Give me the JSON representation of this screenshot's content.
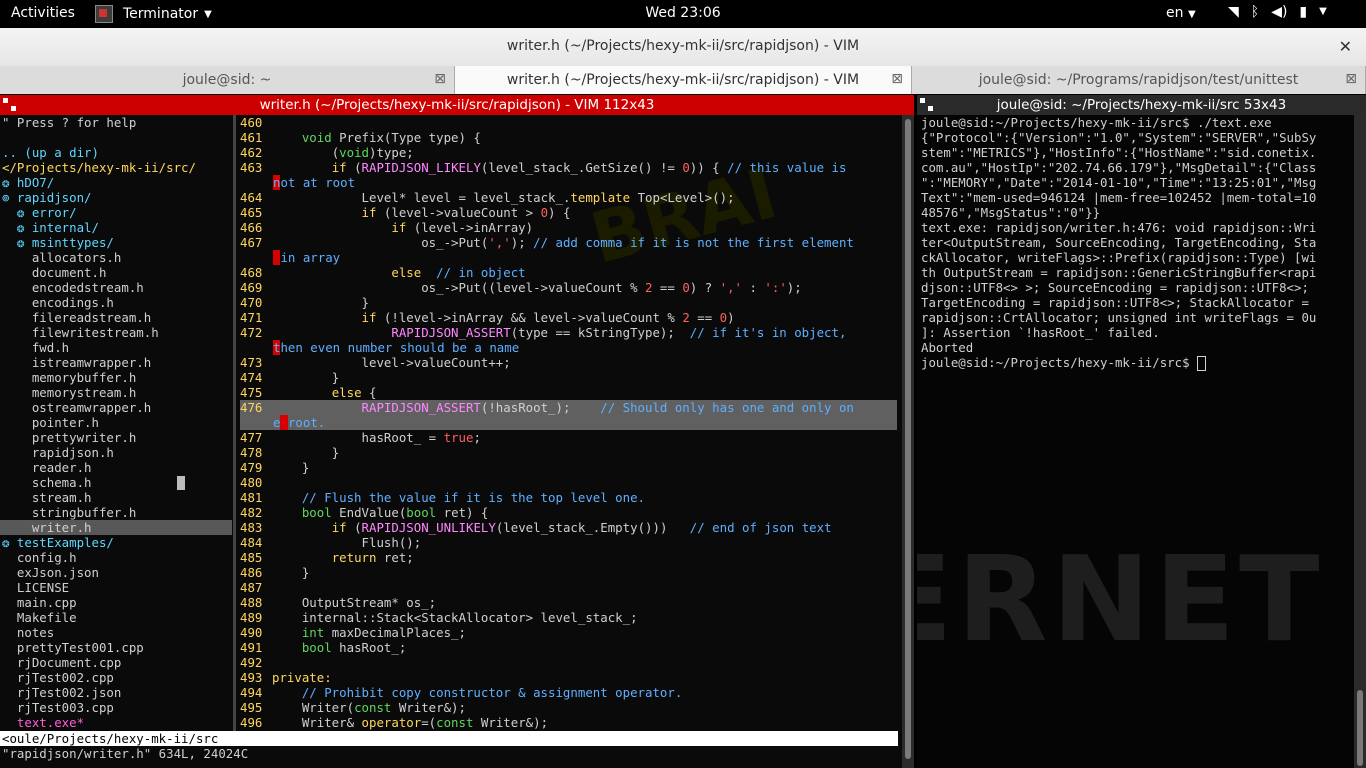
{
  "topbar": {
    "activities": "Activities",
    "app_name": "Terminator",
    "clock": "Wed 23:06",
    "lang": "en"
  },
  "window": {
    "title": "writer.h (~/Projects/hexy-mk-ii/src/rapidjson) - VIM"
  },
  "tabs": [
    {
      "label": "joule@sid: ~"
    },
    {
      "label": "writer.h (~/Projects/hexy-mk-ii/src/rapidjson) - VIM"
    },
    {
      "label": "joule@sid: ~/Programs/rapidjson/test/unittest"
    }
  ],
  "left_pane": {
    "title": "writer.h (~/Projects/hexy-mk-ii/src/rapidjson) - VIM 112x43",
    "tree": [
      {
        "text": "\" Press ? for help",
        "cls": "c-help"
      },
      {
        "text": "",
        "cls": "c-file"
      },
      {
        "text": ".. (up a dir)",
        "cls": "c-dir"
      },
      {
        "text": "</Projects/hexy-mk-ii/src/",
        "cls": "c-hdr"
      },
      {
        "text": "❂ hDO7/",
        "cls": "c-dir"
      },
      {
        "text": "⊚ rapidjson/",
        "cls": "c-dir"
      },
      {
        "text": "  ❂ error/",
        "cls": "c-dir"
      },
      {
        "text": "  ❂ internal/",
        "cls": "c-dir"
      },
      {
        "text": "  ❂ msinttypes/",
        "cls": "c-dir"
      },
      {
        "text": "    allocators.h",
        "cls": "c-file"
      },
      {
        "text": "    document.h",
        "cls": "c-file"
      },
      {
        "text": "    encodedstream.h",
        "cls": "c-file"
      },
      {
        "text": "    encodings.h",
        "cls": "c-file"
      },
      {
        "text": "    filereadstream.h",
        "cls": "c-file"
      },
      {
        "text": "    filewritestream.h",
        "cls": "c-file"
      },
      {
        "text": "    fwd.h",
        "cls": "c-file"
      },
      {
        "text": "    istreamwrapper.h",
        "cls": "c-file"
      },
      {
        "text": "    memorybuffer.h",
        "cls": "c-file"
      },
      {
        "text": "    memorystream.h",
        "cls": "c-file"
      },
      {
        "text": "    ostreamwrapper.h",
        "cls": "c-file"
      },
      {
        "text": "    pointer.h",
        "cls": "c-file"
      },
      {
        "text": "    prettywriter.h",
        "cls": "c-file"
      },
      {
        "text": "    rapidjson.h",
        "cls": "c-file"
      },
      {
        "text": "    reader.h",
        "cls": "c-file"
      },
      {
        "text": "    schema.h",
        "cls": "c-file"
      },
      {
        "text": "    stream.h",
        "cls": "c-file"
      },
      {
        "text": "    stringbuffer.h",
        "cls": "c-file"
      },
      {
        "text": "    writer.h",
        "cls": "c-file sel"
      },
      {
        "text": "❂ testExamples/",
        "cls": "c-dir"
      },
      {
        "text": "  config.h",
        "cls": "c-file"
      },
      {
        "text": "  exJson.json",
        "cls": "c-file"
      },
      {
        "text": "  LICENSE",
        "cls": "c-file"
      },
      {
        "text": "  main.cpp",
        "cls": "c-file"
      },
      {
        "text": "  Makefile",
        "cls": "c-file"
      },
      {
        "text": "  notes",
        "cls": "c-file"
      },
      {
        "text": "  prettyTest001.cpp",
        "cls": "c-file"
      },
      {
        "text": "  rjDocument.cpp",
        "cls": "c-file"
      },
      {
        "text": "  rjTest002.cpp",
        "cls": "c-file"
      },
      {
        "text": "  rjTest002.json",
        "cls": "c-file"
      },
      {
        "text": "  rjTest003.cpp",
        "cls": "c-file"
      },
      {
        "text": "  text.exe*",
        "cls": "c-exe"
      }
    ],
    "code": [
      {
        "n": "460",
        "html": ""
      },
      {
        "n": "461",
        "html": "    <span class='ty'>void</span> <span class='id'>Prefix(Type type) {</span>"
      },
      {
        "n": "462",
        "html": "        <span class='id'>(</span><span class='ty'>void</span><span class='id'>)type;</span>"
      },
      {
        "n": "463",
        "html": "        <span class='kw'>if</span> <span class='id'>(</span><span class='pp'>RAPIDJSON_LIKELY</span><span class='id'>(level_stack_.GetSize() != </span><span class='nm'>0</span><span class='id'>)) { </span><span class='cm'>// this value is</span>"
      },
      {
        "n": "",
        "html": "<span class='cm'><span class='err'>n</span>ot at root</span>"
      },
      {
        "n": "464",
        "html": "            <span class='id'>Level* level = level_stack_.</span><span class='kw'>template</span> <span class='id'>Top&lt;Level&gt;();</span>"
      },
      {
        "n": "465",
        "html": "            <span class='kw'>if</span> <span class='id'>(level-&gt;valueCount &gt; </span><span class='nm'>0</span><span class='id'>) {</span>"
      },
      {
        "n": "466",
        "html": "                <span class='kw'>if</span> <span class='id'>(level-&gt;inArray)</span>"
      },
      {
        "n": "467",
        "html": "                    <span class='id'>os_-&gt;Put(</span><span class='nm'>','</span><span class='id'>); </span><span class='cm'>// add comma if it is not the first element</span>"
      },
      {
        "n": "",
        "html": "<span class='cm'><span class='err'> </span>in array</span>"
      },
      {
        "n": "468",
        "html": "                <span class='kw'>else</span>  <span class='cm'>// in object</span>"
      },
      {
        "n": "469",
        "html": "                    <span class='id'>os_-&gt;Put((level-&gt;valueCount % </span><span class='nm'>2</span><span class='id'> == </span><span class='nm'>0</span><span class='id'>) ? </span><span class='nm'>','</span><span class='id'> : </span><span class='nm'>':'</span><span class='id'>);</span>"
      },
      {
        "n": "470",
        "html": "            <span class='id'>}</span>"
      },
      {
        "n": "471",
        "html": "            <span class='kw'>if</span> <span class='id'>(!level-&gt;inArray &amp;&amp; level-&gt;valueCount % </span><span class='nm'>2</span><span class='id'> == </span><span class='nm'>0</span><span class='id'>)</span>"
      },
      {
        "n": "472",
        "html": "                <span class='pp'>RAPIDJSON_ASSERT</span><span class='id'>(type == kStringType);  </span><span class='cm'>// if it's in object,</span>"
      },
      {
        "n": "",
        "html": "<span class='cm'><span class='err'>t</span>hen even number should be a name</span>"
      },
      {
        "n": "473",
        "html": "            <span class='id'>level-&gt;valueCount++;</span>"
      },
      {
        "n": "474",
        "html": "        <span class='id'>}</span>"
      },
      {
        "n": "475",
        "html": "        <span class='kw'>else</span> <span class='id'>{</span>"
      },
      {
        "n": "476",
        "html": "            <span class='pp'>RAPIDJSON_ASSERT</span><span class='id'>(!hasRoot_);    </span><span class='cm'>// Should only has one and only on</span>",
        "hl": true
      },
      {
        "n": "",
        "html": "<span class='cm'>e<span class='err'> </span>root.</span>",
        "hl": true
      },
      {
        "n": "477",
        "html": "            <span class='id'>hasRoot_ = </span><span class='nm'>true</span><span class='id'>;</span>"
      },
      {
        "n": "478",
        "html": "        <span class='id'>}</span>"
      },
      {
        "n": "479",
        "html": "    <span class='id'>}</span>"
      },
      {
        "n": "480",
        "html": ""
      },
      {
        "n": "481",
        "html": "    <span class='cm'>// Flush the value if it is the top level one.</span>"
      },
      {
        "n": "482",
        "html": "    <span class='ty'>bool</span> <span class='id'>EndValue(</span><span class='ty'>bool</span> <span class='id'>ret) {</span>"
      },
      {
        "n": "483",
        "html": "        <span class='kw'>if</span> <span class='id'>(</span><span class='pp'>RAPIDJSON_UNLIKELY</span><span class='id'>(level_stack_.Empty()))   </span><span class='cm'>// end of json text</span>"
      },
      {
        "n": "484",
        "html": "            <span class='id'>Flush();</span>"
      },
      {
        "n": "485",
        "html": "        <span class='kw'>return</span> <span class='id'>ret;</span>"
      },
      {
        "n": "486",
        "html": "    <span class='id'>}</span>"
      },
      {
        "n": "487",
        "html": ""
      },
      {
        "n": "488",
        "html": "    <span class='id'>OutputStream* os_;</span>"
      },
      {
        "n": "489",
        "html": "    <span class='id'>internal::Stack&lt;StackAllocator&gt; level_stack_;</span>"
      },
      {
        "n": "490",
        "html": "    <span class='ty'>int</span> <span class='id'>maxDecimalPlaces_;</span>"
      },
      {
        "n": "491",
        "html": "    <span class='ty'>bool</span> <span class='id'>hasRoot_;</span>"
      },
      {
        "n": "492",
        "html": ""
      },
      {
        "n": "493",
        "html": "<span class='kw'>private:</span>"
      },
      {
        "n": "494",
        "html": "    <span class='cm'>// Prohibit copy constructor &amp; assignment operator.</span>"
      },
      {
        "n": "495",
        "html": "    <span class='id'>Writer(</span><span class='ty'>const</span> <span class='id'>Writer&amp;);</span>"
      },
      {
        "n": "496",
        "html": "    <span class='id'>Writer&amp; </span><span class='kw'>operator</span><span class='id'>=(</span><span class='ty'>const</span> <span class='id'>Writer&amp;);</span>"
      }
    ],
    "statusline": "<oule/Projects/hexy-mk-ii/src",
    "cmdline": "\"rapidjson/writer.h\" 634L, 24024C"
  },
  "right_pane": {
    "title": "joule@sid: ~/Projects/hexy-mk-ii/src 53x43",
    "lines": [
      "joule@sid:~/Projects/hexy-mk-ii/src$ ./text.exe",
      "{\"Protocol\":{\"Version\":\"1.0\",\"System\":\"SERVER\",\"SubSy",
      "stem\":\"METRICS\"},\"HostInfo\":{\"HostName\":\"sid.conetix.",
      "com.au\",\"HostIp\":\"202.74.66.179\"},\"MsgDetail\":{\"Class",
      "\":\"MEMORY\",\"Date\":\"2014-01-10\",\"Time\":\"13:25:01\",\"Msg",
      "Text\":\"mem-used=946124 |mem-free=102452 |mem-total=10",
      "48576\",\"MsgStatus\":\"0\"}}",
      "text.exe: rapidjson/writer.h:476: void rapidjson::Wri",
      "ter<OutputStream, SourceEncoding, TargetEncoding, Sta",
      "ckAllocator, writeFlags>::Prefix(rapidjson::Type) [wi",
      "th OutputStream = rapidjson::GenericStringBuffer<rapi",
      "djson::UTF8<> >; SourceEncoding = rapidjson::UTF8<>;",
      "TargetEncoding = rapidjson::UTF8<>; StackAllocator =",
      "rapidjson::CrtAllocator; unsigned int writeFlags = 0u",
      "]: Assertion `!hasRoot_' failed.",
      "Aborted",
      "joule@sid:~/Projects/hexy-mk-ii/src$ "
    ]
  },
  "bg": {
    "word": "INTERNET"
  }
}
